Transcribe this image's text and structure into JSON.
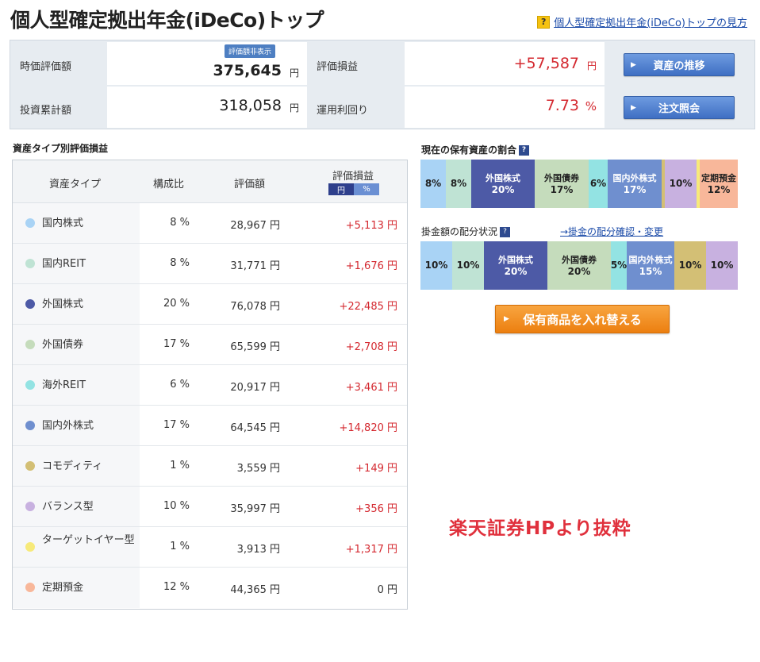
{
  "page": {
    "title": "個人型確定拠出年金(iDeCo)トップ",
    "help_icon": "?",
    "help_link": "個人型確定拠出年金(iDeCo)トップの見方"
  },
  "summary": {
    "current_label": "時価評価額",
    "current_value": "375,645",
    "hidden_badge": "評価額非表示",
    "invested_label": "投資累計額",
    "invested_value": "318,058",
    "pl_label": "評価損益",
    "pl_value": "+57,587",
    "yield_label": "運用利回り",
    "yield_value": "7.73",
    "yield_unit": "%",
    "unit": "円",
    "btn_asset_trend": "資産の推移",
    "btn_order": "注文照会",
    "btn_arrow": "▶"
  },
  "table": {
    "section_title": "資産タイプ別評価損益",
    "col_type": "資産タイプ",
    "col_ratio": "構成比",
    "col_value": "評価額",
    "col_pl": "評価損益",
    "toggle_yen": "円",
    "toggle_pct": "%",
    "rows": [
      {
        "name": "国内株式",
        "ratio": "8 %",
        "value": "28,967 円",
        "pl": "+5,113 円",
        "color": "#a9d3f5"
      },
      {
        "name": "国内REIT",
        "ratio": "8 %",
        "value": "31,771 円",
        "pl": "+1,676 円",
        "color": "#bfe3d4"
      },
      {
        "name": "外国株式",
        "ratio": "20 %",
        "value": "76,078 円",
        "pl": "+22,485 円",
        "color": "#4d5aa6"
      },
      {
        "name": "外国債券",
        "ratio": "17 %",
        "value": "65,599 円",
        "pl": "+2,708 円",
        "color": "#c5dcbc"
      },
      {
        "name": "海外REIT",
        "ratio": "6 %",
        "value": "20,917 円",
        "pl": "+3,461 円",
        "color": "#93e3e3"
      },
      {
        "name": "国内外株式",
        "ratio": "17 %",
        "value": "64,545 円",
        "pl": "+14,820 円",
        "color": "#6f8fcf"
      },
      {
        "name": "コモディティ",
        "ratio": "1 %",
        "value": "3,559 円",
        "pl": "+149 円",
        "color": "#d3bf75"
      },
      {
        "name": "バランス型",
        "ratio": "10 %",
        "value": "35,997 円",
        "pl": "+356 円",
        "color": "#c8b1e0"
      },
      {
        "name": "ターゲットイヤー型",
        "ratio": "1 %",
        "value": "3,913 円",
        "pl": "+1,317 円",
        "color": "#f7ea7a"
      },
      {
        "name": "定期預金",
        "ratio": "12 %",
        "value": "44,365 円",
        "pl": "0 円",
        "color": "#f8b79a"
      }
    ]
  },
  "holdings": {
    "title": "現在の保有資産の割合",
    "help_icon": "?",
    "segments": [
      {
        "label": "",
        "value": "8%",
        "pct": 8,
        "color": "#a9d3f5"
      },
      {
        "label": "",
        "value": "8%",
        "pct": 8,
        "color": "#bfe3d4"
      },
      {
        "label": "外国株式",
        "value": "20%",
        "pct": 20,
        "color": "#4d5aa6"
      },
      {
        "label": "外国債券",
        "value": "17%",
        "pct": 17,
        "color": "#c5dcbc"
      },
      {
        "label": "",
        "value": "6%",
        "pct": 6,
        "color": "#93e3e3"
      },
      {
        "label": "国内外株式",
        "value": "17%",
        "pct": 17,
        "color": "#6f8fcf"
      },
      {
        "label": "",
        "value": "",
        "pct": 1,
        "color": "#d3bf75"
      },
      {
        "label": "",
        "value": "10%",
        "pct": 10,
        "color": "#c8b1e0"
      },
      {
        "label": "",
        "value": "",
        "pct": 1,
        "color": "#f7ea7a"
      },
      {
        "label": "定期預金",
        "value": "12%",
        "pct": 12,
        "color": "#f8b79a"
      }
    ]
  },
  "allocation": {
    "title": "掛金額の配分状況",
    "help_icon": "?",
    "link": "→掛金の配分確認・変更",
    "segments": [
      {
        "label": "",
        "value": "10%",
        "pct": 10,
        "color": "#a9d3f5"
      },
      {
        "label": "",
        "value": "10%",
        "pct": 10,
        "color": "#bfe3d4"
      },
      {
        "label": "外国株式",
        "value": "20%",
        "pct": 20,
        "color": "#4d5aa6"
      },
      {
        "label": "外国債券",
        "value": "20%",
        "pct": 20,
        "color": "#c5dcbc"
      },
      {
        "label": "",
        "value": "5%",
        "pct": 5,
        "color": "#93e3e3"
      },
      {
        "label": "国内外株式",
        "value": "15%",
        "pct": 15,
        "color": "#6f8fcf"
      },
      {
        "label": "",
        "value": "10%",
        "pct": 10,
        "color": "#d3bf75"
      },
      {
        "label": "",
        "value": "10%",
        "pct": 10,
        "color": "#c8b1e0"
      }
    ]
  },
  "actions": {
    "swap_button": "保有商品を入れ替える",
    "btn_arrow": "▶"
  },
  "watermark": "楽天証券HPより抜粋"
}
